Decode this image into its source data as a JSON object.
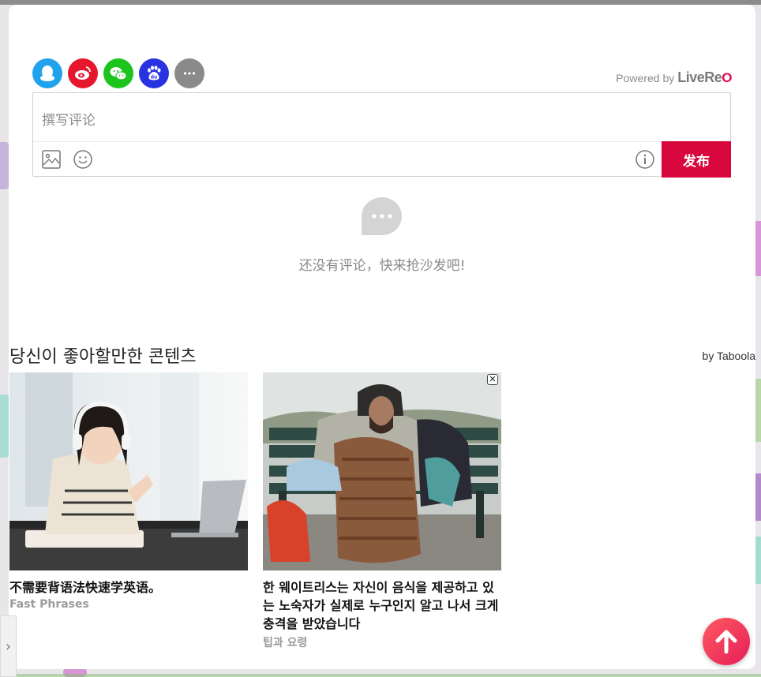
{
  "share": {
    "providers": [
      "qq-icon",
      "weibo-icon",
      "wechat-icon",
      "baidu-icon",
      "more-icon"
    ],
    "colors": {
      "qq": "#20a2ec",
      "weibo": "#e6162d",
      "wechat": "#1cc51d",
      "baidu": "#2932e1",
      "more": "#8a8a8a"
    }
  },
  "powered_by": {
    "prefix": "Powered by",
    "brand": "LiveRe"
  },
  "comment": {
    "placeholder": "撰写评论",
    "publish_label": "发布",
    "accent": "#d8073d"
  },
  "empty_state": {
    "text": "还没有评论，快来抢沙发吧!"
  },
  "recommendations": {
    "title": "당신이 좋아할만한 콘텐츠",
    "provider": "by Taboola",
    "items": [
      {
        "title": "不需要背语法快速学英语。",
        "source": "Fast Phrases"
      },
      {
        "title": "한 웨이트리스는 자신이 음식을 제공하고 있는 노숙자가 실제로 누구인지 알고 나서 크게 충격을 받았습니다",
        "source": "팁과 요령"
      }
    ]
  }
}
